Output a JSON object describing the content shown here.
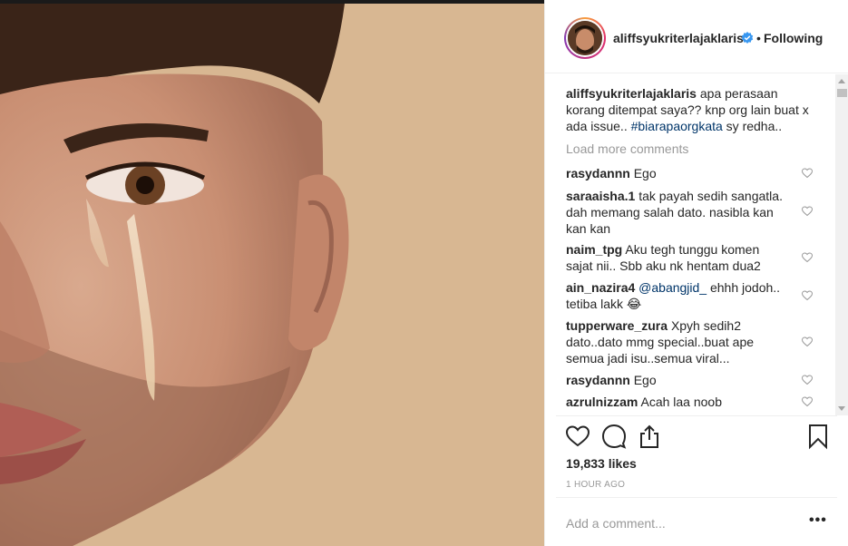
{
  "post": {
    "username": "aliffsyukriterlajaklaris",
    "follow_status": "Following",
    "separator": "•",
    "caption": {
      "username": "aliffsyukriterlajaklaris",
      "text_before": " apa perasaan korang ditempat saya?? knp org lain buat x ada issue.. ",
      "hashtag": "#biarapaorgkata",
      "text_after": " sy redha.."
    },
    "load_more": "Load more comments",
    "comments": [
      {
        "user": "rasydannn",
        "text": "Ego"
      },
      {
        "user": "saraaisha.1",
        "text": "tak payah sedih sangatla. dah memang salah dato. nasibla kan kan kan"
      },
      {
        "user": "naim_tpg",
        "text": "Aku tegh tunggu komen sajat nii.. Sbb aku nk hentam dua2"
      },
      {
        "user": "ain_nazira4",
        "mention": "@abangjid_",
        "text": " ehhh jodoh.. tetiba lakk 😂"
      },
      {
        "user": "tupperware_zura",
        "text": "Xpyh sedih2 dato..dato mmg special..buat ape semua jadi isu..semua viral..."
      },
      {
        "user": "rasydannn",
        "text": "Ego"
      },
      {
        "user": "azrulnizzam",
        "text": "Acah laa noob"
      }
    ],
    "likes": "19,833 likes",
    "time_ago": "1 HOUR AGO",
    "add_comment_placeholder": "Add a comment...",
    "more_options": "•••"
  },
  "icons": {
    "verified": "verified-badge-icon",
    "like": "heart-outline-icon",
    "comment": "comment-bubble-icon",
    "share": "share-upload-icon",
    "save": "bookmark-icon",
    "comment_like": "small-heart-icon"
  },
  "colors": {
    "verified_blue": "#3897f0",
    "link_blue": "#003569",
    "muted_gray": "#999999",
    "text": "#262626"
  }
}
